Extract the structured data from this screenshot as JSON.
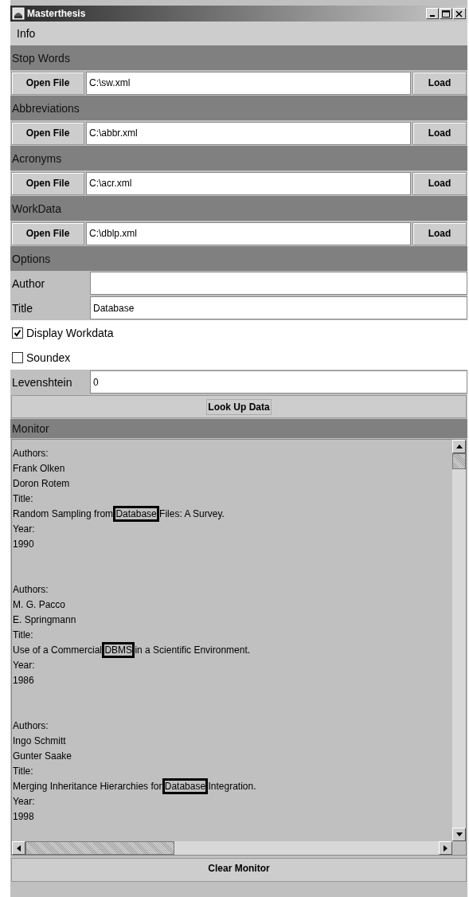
{
  "window": {
    "title": "Masterthesis"
  },
  "menu": [
    {
      "label": "Info"
    }
  ],
  "file_sections": [
    {
      "title": "Stop Words",
      "open_button": "Open File",
      "path": "C:\\sw.xml",
      "load_button": "Load"
    },
    {
      "title": "Abbreviations",
      "open_button": "Open File",
      "path": "C:\\abbr.xml",
      "load_button": "Load"
    },
    {
      "title": "Acronyms",
      "open_button": "Open File",
      "path": "C:\\acr.xml",
      "load_button": "Load"
    },
    {
      "title": "WorkData",
      "open_button": "Open File",
      "path": "C:\\dblp.xml",
      "load_button": "Load"
    }
  ],
  "options": {
    "title": "Options",
    "items": [
      {
        "kind": "field",
        "label": "Author",
        "value": ""
      },
      {
        "kind": "field",
        "label": "Title",
        "value": "Database"
      },
      {
        "kind": "checkbox",
        "label": "Display Workdata",
        "checked": true
      },
      {
        "kind": "checkbox",
        "label": "Soundex",
        "checked": false
      },
      {
        "kind": "field",
        "label": "Levenshtein",
        "value": "0"
      }
    ],
    "button": "Look Up Data"
  },
  "monitor": {
    "title": "Monitor",
    "records": [
      {
        "authors_label": "Authors:",
        "authors": [
          "Frank Olken",
          "Doron Rotem"
        ],
        "title_label": "Title:",
        "title_before": "Random Sampling from ",
        "title_match": "Database",
        "title_after": " Files: A Survey.",
        "year_label": "Year:",
        "year": "1990"
      },
      {
        "authors_label": "Authors:",
        "authors": [
          "M. G. Pacco",
          "E. Springmann"
        ],
        "title_label": "Title:",
        "title_before": "Use of a Commercial ",
        "title_match": "DBMS",
        "title_after": " in a Scientific Environment.",
        "year_label": "Year:",
        "year": "1986"
      },
      {
        "authors_label": "Authors:",
        "authors": [
          "Ingo Schmitt",
          "Gunter Saake"
        ],
        "title_label": "Title:",
        "title_before": "Merging Inheritance Hierarchies for ",
        "title_match": "Database",
        "title_after": " Integration.",
        "year_label": "Year:",
        "year": "1998"
      }
    ],
    "clear_button": "Clear Monitor"
  }
}
